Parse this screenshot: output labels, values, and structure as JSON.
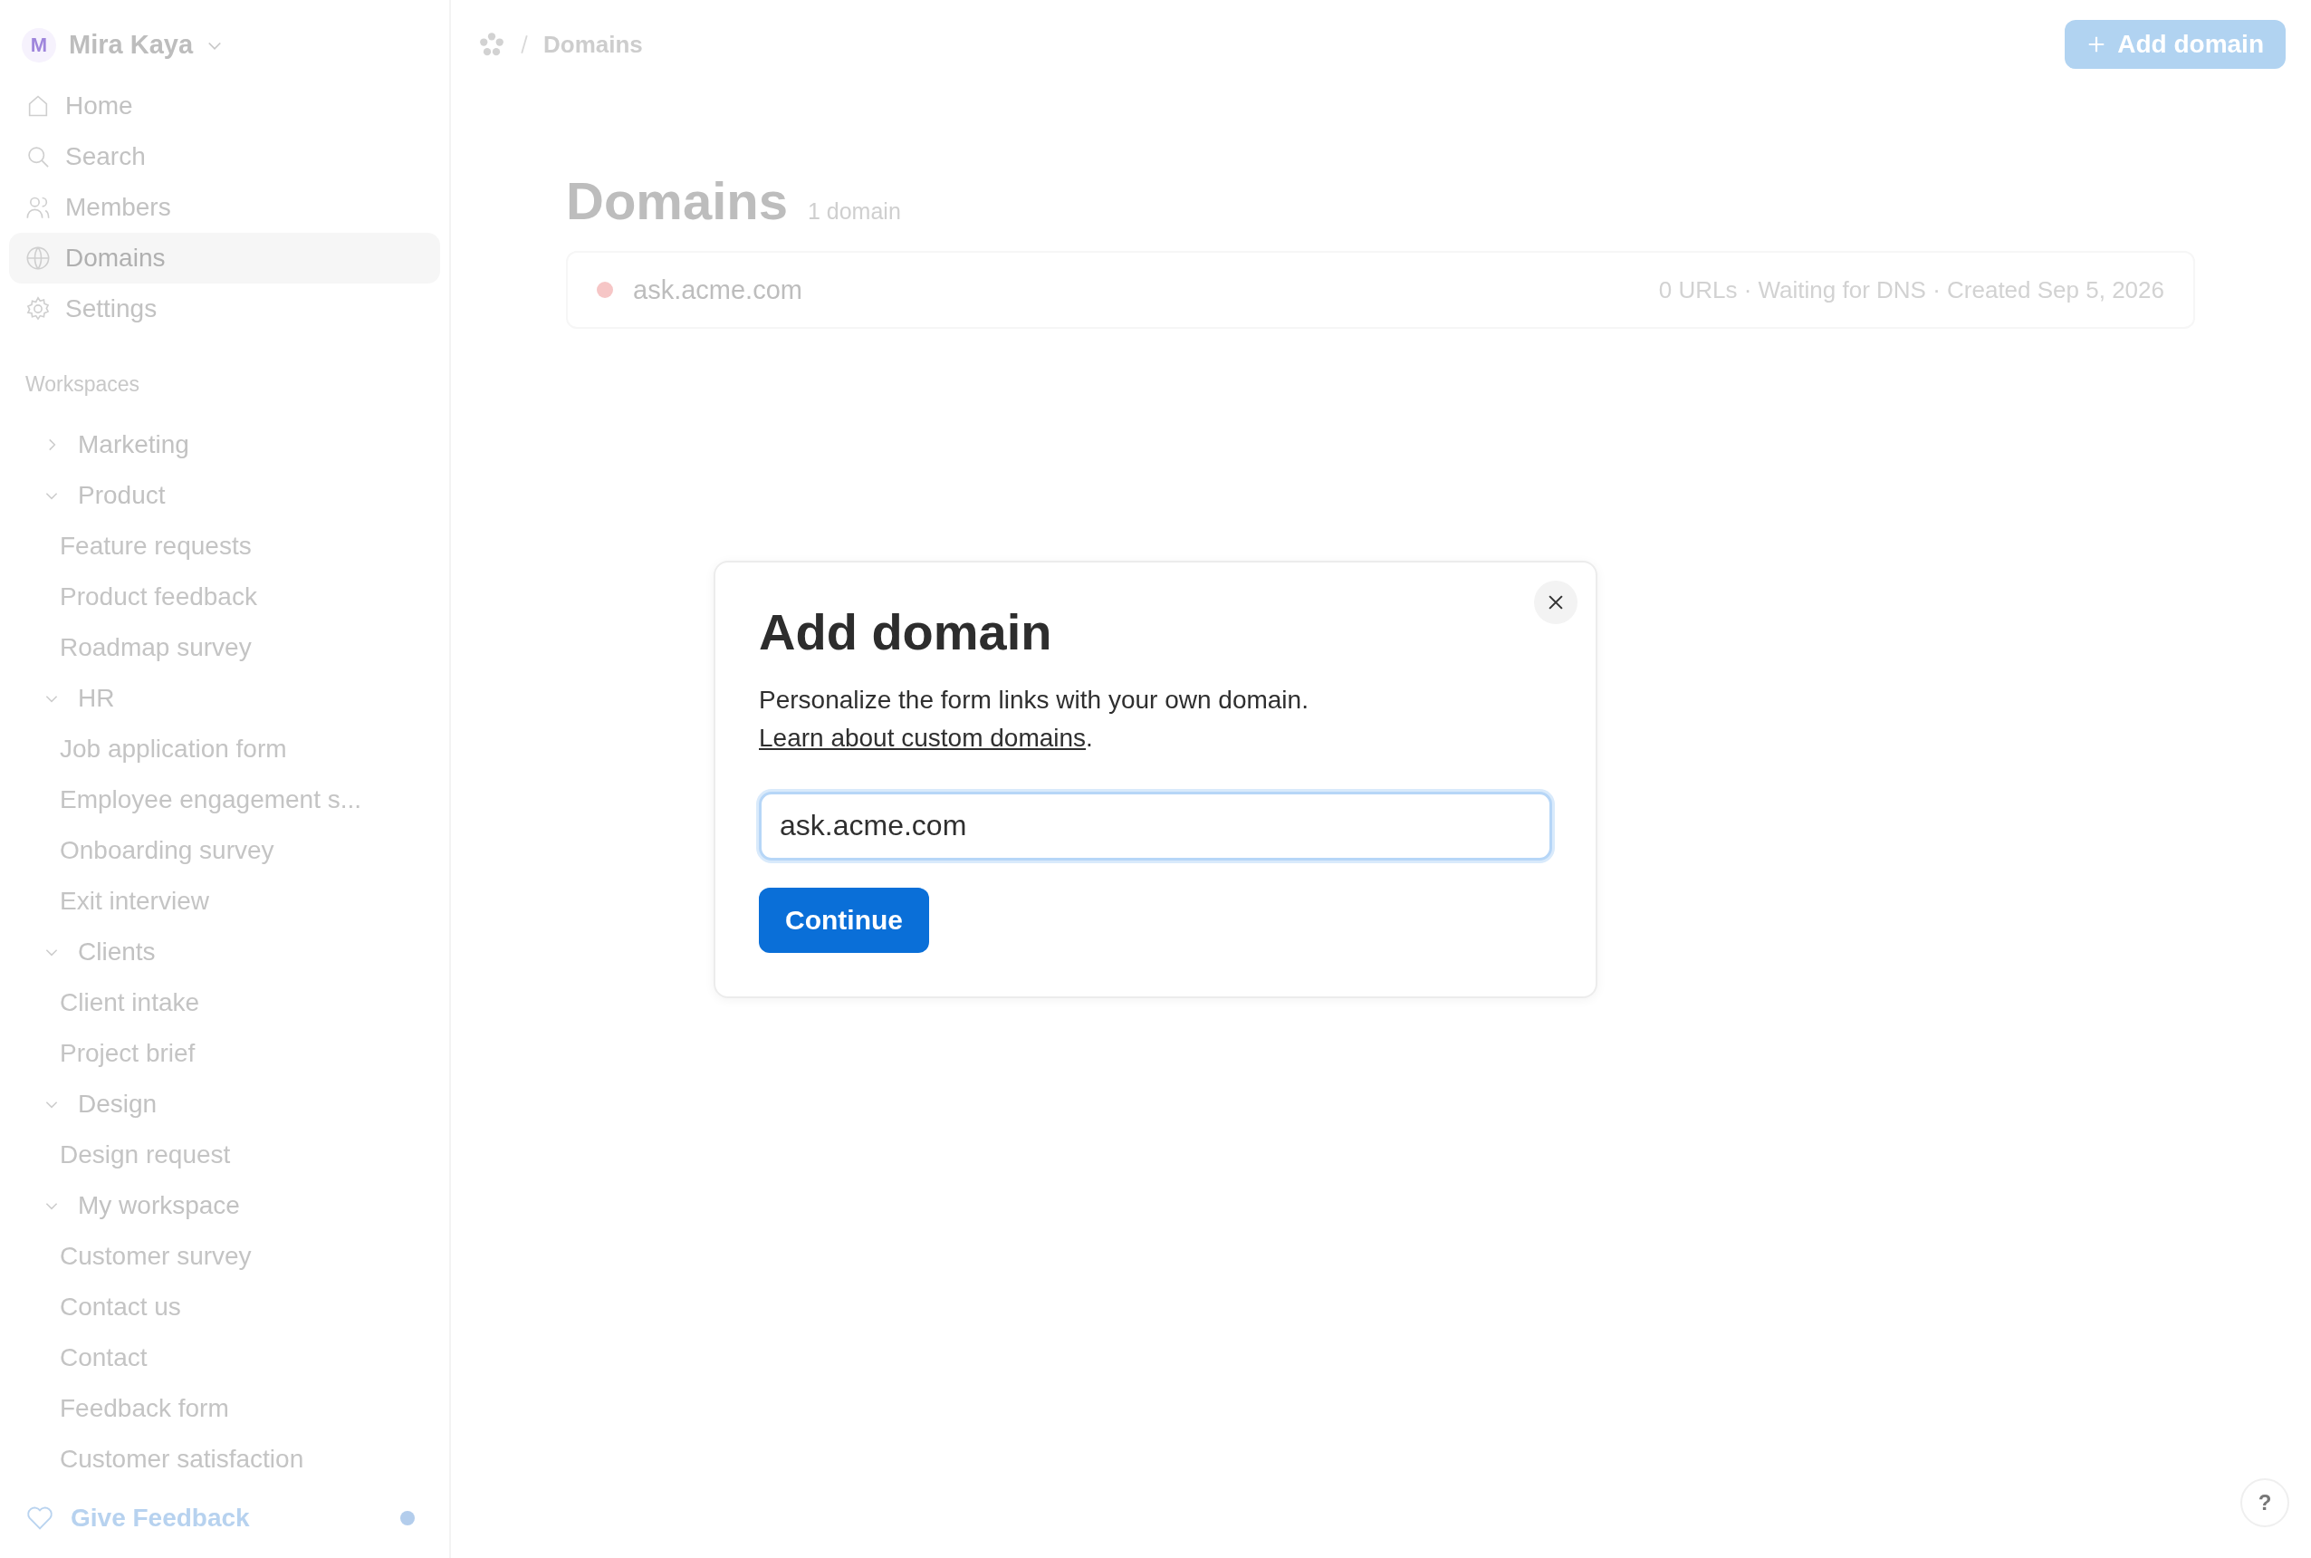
{
  "user": {
    "initial": "M",
    "name": "Mira Kaya"
  },
  "nav": [
    {
      "label": "Home",
      "selected": false
    },
    {
      "label": "Search",
      "selected": false
    },
    {
      "label": "Members",
      "selected": false
    },
    {
      "label": "Domains",
      "selected": true
    },
    {
      "label": "Settings",
      "selected": false
    }
  ],
  "workspaces_heading": "Workspaces",
  "workspaces": [
    {
      "label": "Marketing",
      "expanded": false
    },
    {
      "label": "Product",
      "expanded": true,
      "children": [
        "Feature requests",
        "Product feedback",
        "Roadmap survey"
      ]
    },
    {
      "label": "HR",
      "expanded": true,
      "children": [
        "Job application form",
        "Employee engagement s...",
        "Onboarding survey",
        "Exit interview"
      ]
    },
    {
      "label": "Clients",
      "expanded": true,
      "children": [
        "Client intake",
        "Project brief"
      ]
    },
    {
      "label": "Design",
      "expanded": true,
      "children": [
        "Design request"
      ]
    },
    {
      "label": "My workspace",
      "expanded": true,
      "children": [
        "Customer survey",
        "Contact us",
        "Contact",
        "Feedback form",
        "Customer satisfaction"
      ]
    }
  ],
  "feedback": {
    "label": "Give Feedback",
    "unread": true
  },
  "breadcrumb": {
    "current": "Domains"
  },
  "add_button": "Add domain",
  "page": {
    "title": "Domains",
    "count": "1 domain"
  },
  "domains": [
    {
      "name": "ask.acme.com",
      "color": "#f6c6c6",
      "meta": "0 URLs · Waiting for DNS · Created Sep 5, 2026"
    }
  ],
  "dialog": {
    "title": "Add domain",
    "text": "Personalize the form links with your own domain.",
    "link": "Learn about custom domains",
    "after": ".",
    "value": "ask.acme.com",
    "button": "Continue"
  },
  "help": "?"
}
